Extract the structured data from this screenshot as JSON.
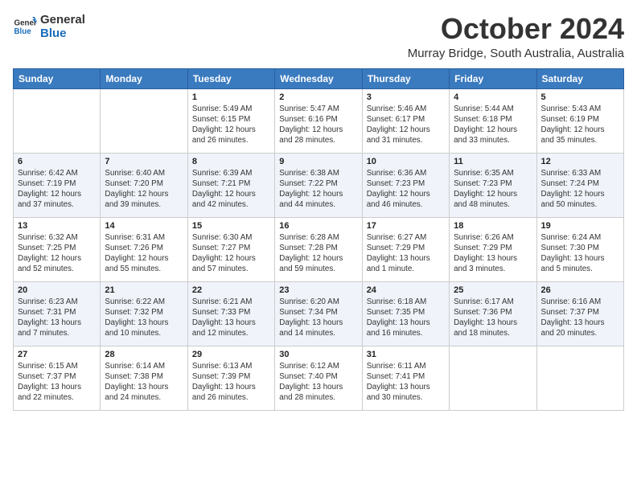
{
  "header": {
    "logo_line1": "General",
    "logo_line2": "Blue",
    "month_year": "October 2024",
    "location": "Murray Bridge, South Australia, Australia"
  },
  "weekdays": [
    "Sunday",
    "Monday",
    "Tuesday",
    "Wednesday",
    "Thursday",
    "Friday",
    "Saturday"
  ],
  "weeks": [
    [
      {
        "day": "",
        "info": ""
      },
      {
        "day": "",
        "info": ""
      },
      {
        "day": "1",
        "info": "Sunrise: 5:49 AM\nSunset: 6:15 PM\nDaylight: 12 hours and 26 minutes."
      },
      {
        "day": "2",
        "info": "Sunrise: 5:47 AM\nSunset: 6:16 PM\nDaylight: 12 hours and 28 minutes."
      },
      {
        "day": "3",
        "info": "Sunrise: 5:46 AM\nSunset: 6:17 PM\nDaylight: 12 hours and 31 minutes."
      },
      {
        "day": "4",
        "info": "Sunrise: 5:44 AM\nSunset: 6:18 PM\nDaylight: 12 hours and 33 minutes."
      },
      {
        "day": "5",
        "info": "Sunrise: 5:43 AM\nSunset: 6:19 PM\nDaylight: 12 hours and 35 minutes."
      }
    ],
    [
      {
        "day": "6",
        "info": "Sunrise: 6:42 AM\nSunset: 7:19 PM\nDaylight: 12 hours and 37 minutes."
      },
      {
        "day": "7",
        "info": "Sunrise: 6:40 AM\nSunset: 7:20 PM\nDaylight: 12 hours and 39 minutes."
      },
      {
        "day": "8",
        "info": "Sunrise: 6:39 AM\nSunset: 7:21 PM\nDaylight: 12 hours and 42 minutes."
      },
      {
        "day": "9",
        "info": "Sunrise: 6:38 AM\nSunset: 7:22 PM\nDaylight: 12 hours and 44 minutes."
      },
      {
        "day": "10",
        "info": "Sunrise: 6:36 AM\nSunset: 7:23 PM\nDaylight: 12 hours and 46 minutes."
      },
      {
        "day": "11",
        "info": "Sunrise: 6:35 AM\nSunset: 7:23 PM\nDaylight: 12 hours and 48 minutes."
      },
      {
        "day": "12",
        "info": "Sunrise: 6:33 AM\nSunset: 7:24 PM\nDaylight: 12 hours and 50 minutes."
      }
    ],
    [
      {
        "day": "13",
        "info": "Sunrise: 6:32 AM\nSunset: 7:25 PM\nDaylight: 12 hours and 52 minutes."
      },
      {
        "day": "14",
        "info": "Sunrise: 6:31 AM\nSunset: 7:26 PM\nDaylight: 12 hours and 55 minutes."
      },
      {
        "day": "15",
        "info": "Sunrise: 6:30 AM\nSunset: 7:27 PM\nDaylight: 12 hours and 57 minutes."
      },
      {
        "day": "16",
        "info": "Sunrise: 6:28 AM\nSunset: 7:28 PM\nDaylight: 12 hours and 59 minutes."
      },
      {
        "day": "17",
        "info": "Sunrise: 6:27 AM\nSunset: 7:29 PM\nDaylight: 13 hours and 1 minute."
      },
      {
        "day": "18",
        "info": "Sunrise: 6:26 AM\nSunset: 7:29 PM\nDaylight: 13 hours and 3 minutes."
      },
      {
        "day": "19",
        "info": "Sunrise: 6:24 AM\nSunset: 7:30 PM\nDaylight: 13 hours and 5 minutes."
      }
    ],
    [
      {
        "day": "20",
        "info": "Sunrise: 6:23 AM\nSunset: 7:31 PM\nDaylight: 13 hours and 7 minutes."
      },
      {
        "day": "21",
        "info": "Sunrise: 6:22 AM\nSunset: 7:32 PM\nDaylight: 13 hours and 10 minutes."
      },
      {
        "day": "22",
        "info": "Sunrise: 6:21 AM\nSunset: 7:33 PM\nDaylight: 13 hours and 12 minutes."
      },
      {
        "day": "23",
        "info": "Sunrise: 6:20 AM\nSunset: 7:34 PM\nDaylight: 13 hours and 14 minutes."
      },
      {
        "day": "24",
        "info": "Sunrise: 6:18 AM\nSunset: 7:35 PM\nDaylight: 13 hours and 16 minutes."
      },
      {
        "day": "25",
        "info": "Sunrise: 6:17 AM\nSunset: 7:36 PM\nDaylight: 13 hours and 18 minutes."
      },
      {
        "day": "26",
        "info": "Sunrise: 6:16 AM\nSunset: 7:37 PM\nDaylight: 13 hours and 20 minutes."
      }
    ],
    [
      {
        "day": "27",
        "info": "Sunrise: 6:15 AM\nSunset: 7:37 PM\nDaylight: 13 hours and 22 minutes."
      },
      {
        "day": "28",
        "info": "Sunrise: 6:14 AM\nSunset: 7:38 PM\nDaylight: 13 hours and 24 minutes."
      },
      {
        "day": "29",
        "info": "Sunrise: 6:13 AM\nSunset: 7:39 PM\nDaylight: 13 hours and 26 minutes."
      },
      {
        "day": "30",
        "info": "Sunrise: 6:12 AM\nSunset: 7:40 PM\nDaylight: 13 hours and 28 minutes."
      },
      {
        "day": "31",
        "info": "Sunrise: 6:11 AM\nSunset: 7:41 PM\nDaylight: 13 hours and 30 minutes."
      },
      {
        "day": "",
        "info": ""
      },
      {
        "day": "",
        "info": ""
      }
    ]
  ]
}
